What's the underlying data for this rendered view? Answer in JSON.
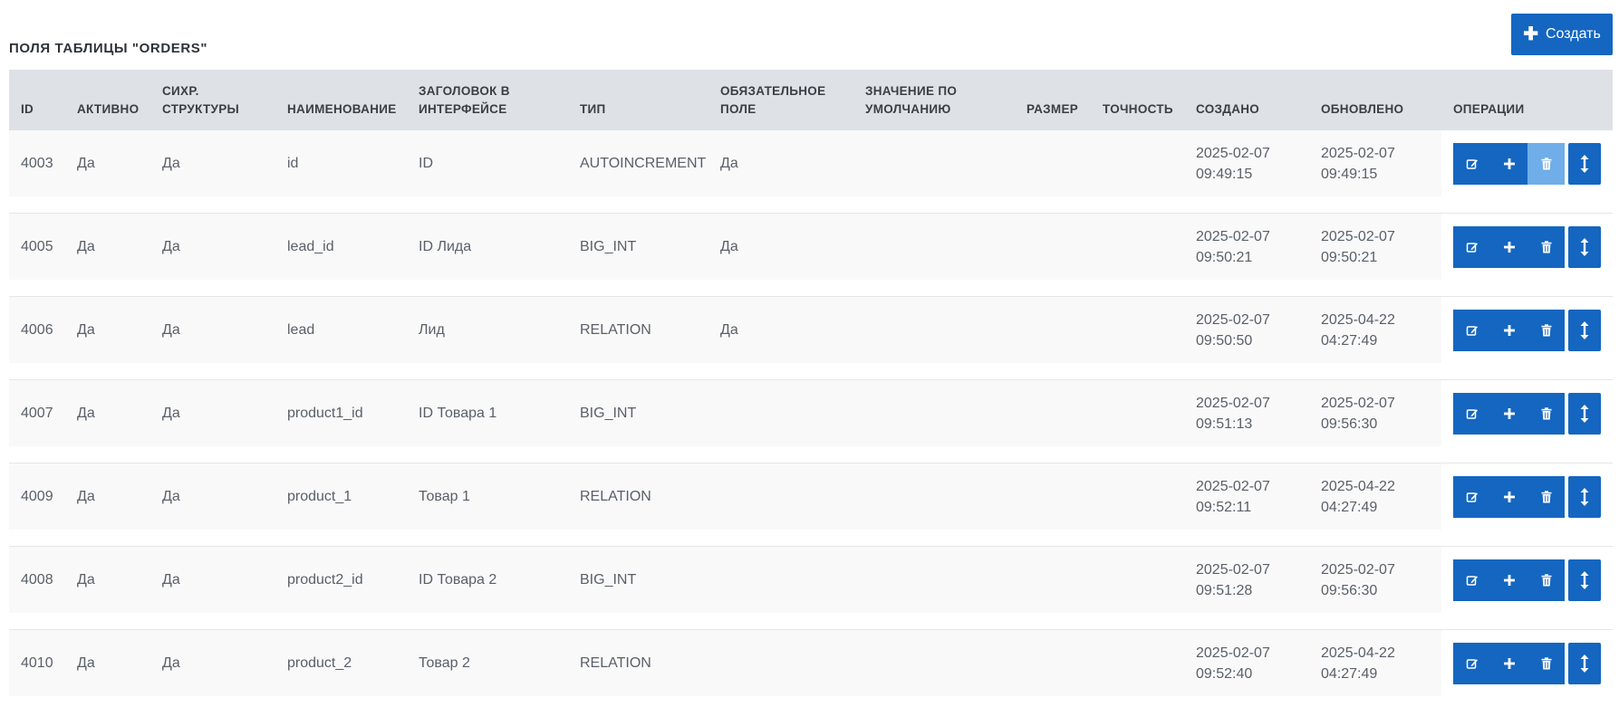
{
  "header": {
    "title": "ПОЛЯ ТАБЛИЦЫ \"ORDERS\"",
    "create_label": "Создать",
    "create_icon": "plus-icon"
  },
  "table": {
    "columns": [
      "ID",
      "АКТИВНО",
      "СИХР.\nСТРУКТУРЫ",
      "НАИМЕНОВАНИЕ",
      "ЗАГОЛОВОК В\nИНТЕРФЕЙСЕ",
      "ТИП",
      "ОБЯЗАТЕЛЬНОЕ\nПОЛЕ",
      "ЗНАЧЕНИЕ ПО\nУМОЛЧАНИЮ",
      "РАЗМЕР",
      "ТОЧНОСТЬ",
      "СОЗДАНО",
      "ОБНОВЛЕНО",
      "ОПЕРАЦИИ"
    ],
    "rows": [
      {
        "id": "4003",
        "active": "Да",
        "sync": "Да",
        "name": "id",
        "label": "ID",
        "type": "AUTOINCREMENT",
        "required": "Да",
        "default": "",
        "size": "",
        "precision": "",
        "created": "2025-02-07\n09:49:15",
        "updated": "2025-02-07\n09:49:15",
        "delete_disabled": true
      },
      {
        "id": "4005",
        "active": "Да",
        "sync": "Да",
        "name": "lead_id",
        "label": "ID Лида",
        "type": "BIG_INT",
        "required": "Да",
        "default": "",
        "size": "",
        "precision": "",
        "created": "2025-02-07\n09:50:21",
        "updated": "2025-02-07\n09:50:21",
        "delete_disabled": false
      },
      {
        "id": "4006",
        "active": "Да",
        "sync": "Да",
        "name": "lead",
        "label": "Лид",
        "type": "RELATION",
        "required": "Да",
        "default": "",
        "size": "",
        "precision": "",
        "created": "2025-02-07\n09:50:50",
        "updated": "2025-04-22\n04:27:49",
        "delete_disabled": false
      },
      {
        "id": "4007",
        "active": "Да",
        "sync": "Да",
        "name": "product1_id",
        "label": "ID Товара 1",
        "type": "BIG_INT",
        "required": "",
        "default": "",
        "size": "",
        "precision": "",
        "created": "2025-02-07\n09:51:13",
        "updated": "2025-02-07\n09:56:30",
        "delete_disabled": false
      },
      {
        "id": "4009",
        "active": "Да",
        "sync": "Да",
        "name": "product_1",
        "label": "Товар 1",
        "type": "RELATION",
        "required": "",
        "default": "",
        "size": "",
        "precision": "",
        "created": "2025-02-07\n09:52:11",
        "updated": "2025-04-22\n04:27:49",
        "delete_disabled": false
      },
      {
        "id": "4008",
        "active": "Да",
        "sync": "Да",
        "name": "product2_id",
        "label": "ID Товара 2",
        "type": "BIG_INT",
        "required": "",
        "default": "",
        "size": "",
        "precision": "",
        "created": "2025-02-07\n09:51:28",
        "updated": "2025-02-07\n09:56:30",
        "delete_disabled": false
      },
      {
        "id": "4010",
        "active": "Да",
        "sync": "Да",
        "name": "product_2",
        "label": "Товар 2",
        "type": "RELATION",
        "required": "",
        "default": "",
        "size": "",
        "precision": "",
        "created": "2025-02-07\n09:52:40",
        "updated": "2025-04-22\n04:27:49",
        "delete_disabled": false
      }
    ],
    "operation_icons": [
      "edit-icon",
      "plus-icon",
      "trash-icon",
      "move-vertical-icon"
    ]
  },
  "colors": {
    "primary": "#1466c0",
    "primary_disabled": "#6faee9",
    "header_bg": "#dee1e6",
    "row_bg": "#f9f9f9"
  }
}
